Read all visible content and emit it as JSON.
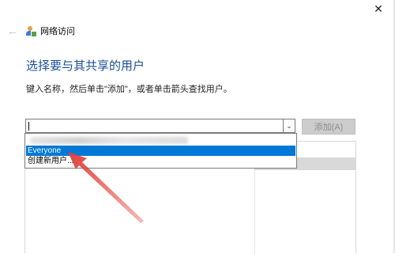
{
  "window": {
    "close_glyph": "✕",
    "back_glyph": "←",
    "title": "网络访问"
  },
  "main": {
    "heading": "选择要与其共享的用户",
    "instruction": "键入名称，然后单击\"添加\"，或者单击箭头查找用户。"
  },
  "combo": {
    "value": "",
    "dropdown_glyph": "⌄"
  },
  "add_button": {
    "label": "添加(A)",
    "state": "disabled"
  },
  "dropdown": {
    "items": [
      {
        "label": "Everyone",
        "selected": true
      },
      {
        "label": "创建新用户...",
        "selected": false
      }
    ]
  },
  "annotation": {
    "color": "#e0403a"
  },
  "colors": {
    "accent": "#0078d7",
    "heading": "#1a4f98"
  }
}
